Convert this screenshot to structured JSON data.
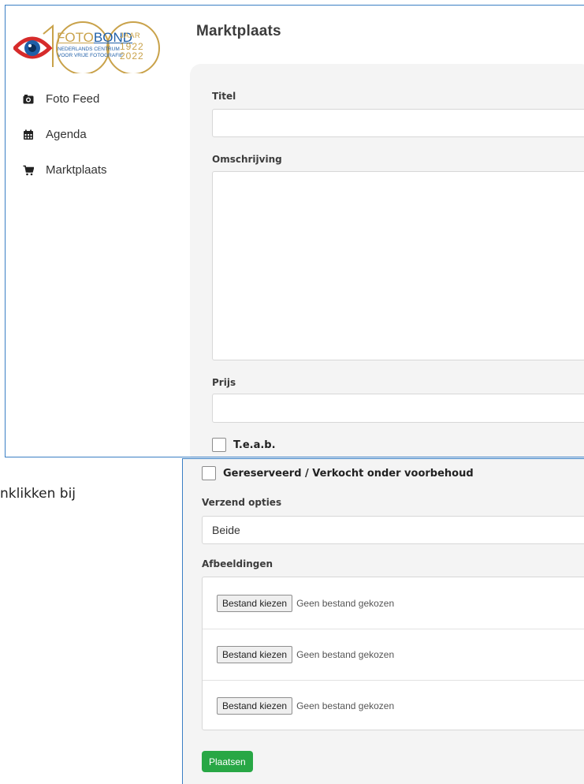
{
  "sidebar": {
    "logo": {
      "word_foto": "FOTO",
      "word_bond": "BOND",
      "word_jaar": "JAAR",
      "line1": "NEDERLANDS CENTRUM",
      "line2": "VOOR VRIJE FOTOGRAFIE",
      "year_start": "1922",
      "year_end": "2022",
      "colors": {
        "gold": "#c9a24a",
        "blue": "#1f5fa8",
        "red": "#d62b2b"
      }
    },
    "items": [
      {
        "label": "Foto Feed",
        "icon": "camera-icon"
      },
      {
        "label": "Agenda",
        "icon": "calendar-icon"
      },
      {
        "label": "Marktplaats",
        "icon": "shopping-cart-icon"
      }
    ]
  },
  "page": {
    "title": "Marktplaats"
  },
  "form": {
    "title_label": "Titel",
    "title_value": "",
    "description_label": "Omschrijving",
    "description_value": "",
    "price_label": "Prijs",
    "price_value": "",
    "teab_label": "T.e.a.b.",
    "reserved_label": "Gereserveerd / Verkocht onder voorbehoud",
    "shipping_label": "Verzend opties",
    "shipping_selected": "Beide",
    "images_label": "Afbeeldingen",
    "files": [
      {
        "button": "Bestand kiezen",
        "status": "Geen bestand gekozen"
      },
      {
        "button": "Bestand kiezen",
        "status": "Geen bestand gekozen"
      },
      {
        "button": "Bestand kiezen",
        "status": "Geen bestand gekozen"
      }
    ],
    "submit_label": "Plaatsen"
  },
  "background_fragment": "nklikken bij",
  "colors": {
    "frame": "#3a7fc4",
    "submit": "#28a745",
    "panel": "#f4f4f4"
  }
}
